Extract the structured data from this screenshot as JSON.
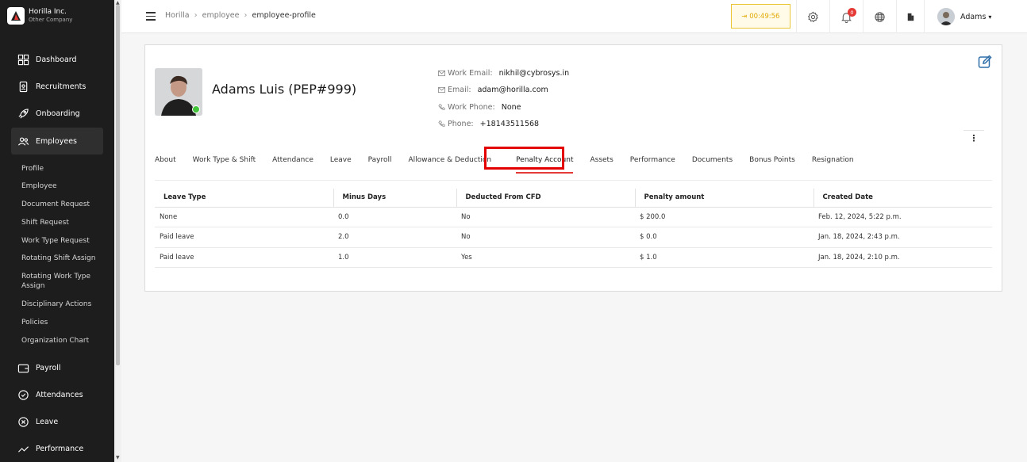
{
  "company": {
    "name": "Horilla Inc.",
    "subtitle": "Other Company"
  },
  "sidebar": {
    "items": [
      {
        "label": "Dashboard",
        "icon": "dashboard-icon"
      },
      {
        "label": "Recruitments",
        "icon": "recruitment-icon"
      },
      {
        "label": "Onboarding",
        "icon": "rocket-icon"
      },
      {
        "label": "Employees",
        "icon": "people-icon"
      },
      {
        "label": "Payroll",
        "icon": "wallet-icon"
      },
      {
        "label": "Attendances",
        "icon": "clock-check-icon"
      },
      {
        "label": "Leave",
        "icon": "close-circle-icon"
      },
      {
        "label": "Performance",
        "icon": "trend-icon"
      }
    ],
    "subitems": [
      "Profile",
      "Employee",
      "Document Request",
      "Shift Request",
      "Work Type Request",
      "Rotating Shift Assign",
      "Rotating Work Type Assign",
      "Disciplinary Actions",
      "Policies",
      "Organization Chart"
    ]
  },
  "breadcrumb": [
    "Horilla",
    "employee",
    "employee-profile"
  ],
  "topbar": {
    "timer": "00:49:56",
    "notification_count": "0",
    "user_name": "Adams"
  },
  "profile": {
    "name": "Adams Luis (PEP#999)",
    "contacts": [
      {
        "label": "Work Email:",
        "value": "nikhil@cybrosys.in",
        "icon": "mail-icon"
      },
      {
        "label": "Email:",
        "value": "adam@horilla.com",
        "icon": "mail-icon"
      },
      {
        "label": "Work Phone:",
        "value": "None",
        "icon": "phone-icon"
      },
      {
        "label": "Phone:",
        "value": "+18143511568",
        "icon": "phone-icon"
      }
    ],
    "more_label": "⋮"
  },
  "tabs": [
    "About",
    "Work Type & Shift",
    "Attendance",
    "Leave",
    "Payroll",
    "Allowance & Deduction",
    "Penalty Account",
    "Assets",
    "Performance",
    "Documents",
    "Bonus Points",
    "Resignation"
  ],
  "active_tab": "Penalty Account",
  "penalty_table": {
    "headers": [
      "Leave Type",
      "Minus Days",
      "Deducted From CFD",
      "Penalty amount",
      "Created Date"
    ],
    "rows": [
      [
        "None",
        "0.0",
        "No",
        "$ 200.0",
        "Feb. 12, 2024, 5:22 p.m."
      ],
      [
        "Paid leave",
        "2.0",
        "No",
        "$ 0.0",
        "Jan. 18, 2024, 2:43 p.m."
      ],
      [
        "Paid leave",
        "1.0",
        "Yes",
        "$ 1.0",
        "Jan. 18, 2024, 2:10 p.m."
      ]
    ]
  },
  "colors": {
    "accent": "#e53935",
    "highlight_box": "#e30000",
    "timer": "#e0a800",
    "online": "#43c43b"
  }
}
